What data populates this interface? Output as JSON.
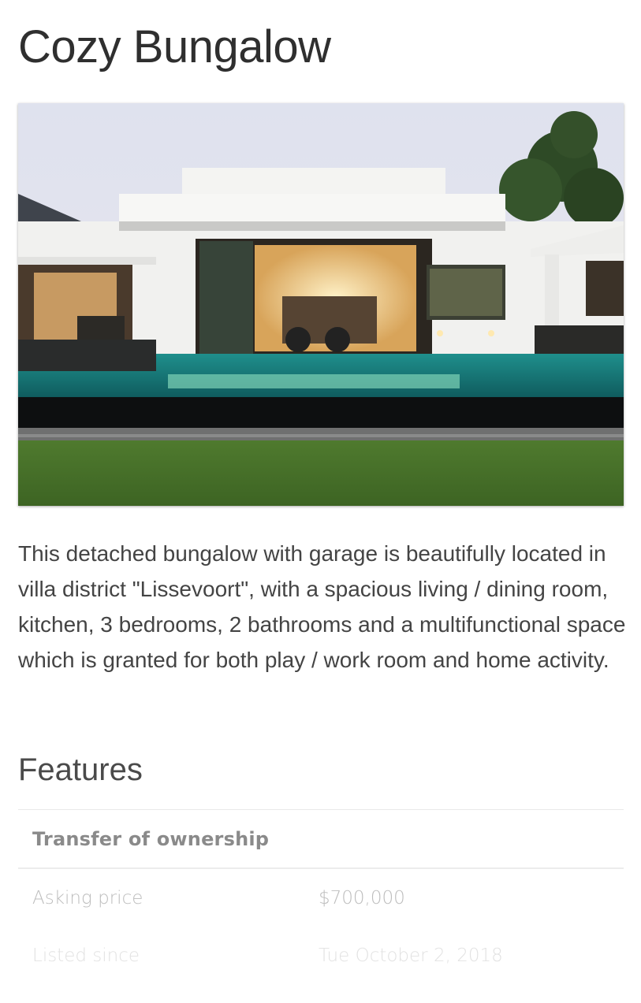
{
  "listing": {
    "title": "Cozy Bungalow",
    "image_alt": "Modern white bungalow with pool",
    "description": "This detached bungalow with garage is beautifully located in villa district \"Lissevoort\", with a spacious living / dining room, kitchen, 3 bedrooms, 2 bathrooms and a multifunctional space which is granted for both play / work room and home activity."
  },
  "features": {
    "title": "Features",
    "group_header": "Transfer of ownership",
    "rows": [
      {
        "label": "Asking price",
        "value": "$700,000"
      },
      {
        "label": "Listed since",
        "value": "Tue October 2, 2018"
      }
    ]
  }
}
